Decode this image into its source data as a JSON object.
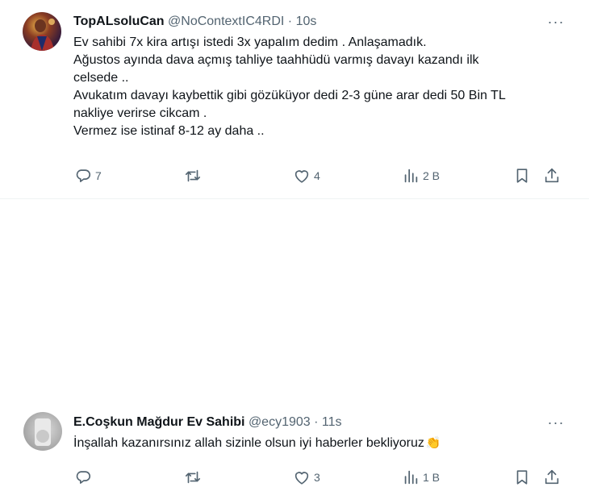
{
  "tweets": [
    {
      "display_name": "TopALsoluCan",
      "handle": "@NoContextIC4RDI",
      "separator": "·",
      "time": "10s",
      "text_lines": [
        "Ev sahibi 7x kira artışı istedi 3x yapalım dedim . Anlaşamadık.",
        "Ağustos ayında dava açmış tahliye taahhüdü varmış davayı kazandı ilk",
        "celsede ..",
        "Avukatım davayı kaybettik gibi gözüküyor dedi 2-3 güne arar dedi 50 Bin TL",
        "nakliye verirse cikcam .",
        "Vermez ise istinaf 8-12 ay daha .."
      ],
      "replies": "7",
      "retweets": "",
      "likes": "4",
      "views": "2 B"
    },
    {
      "display_name": "E.Coşkun Mağdur Ev Sahibi",
      "handle": "@ecy1903",
      "separator": "·",
      "time": "11s",
      "text_lines": [
        "İnşallah kazanırsınız allah sizinle olsun iyi haberler bekliyoruz"
      ],
      "emoji": "👏",
      "replies": "",
      "retweets": "",
      "likes": "3",
      "views": "1 B"
    }
  ],
  "icons": {
    "more": "more-horizontal-icon",
    "reply": "reply-icon",
    "retweet": "retweet-icon",
    "like": "heart-icon",
    "views": "views-chart-icon",
    "bookmark": "bookmark-icon",
    "share": "share-icon"
  },
  "colors": {
    "text": "#0f1419",
    "secondary": "#536471",
    "divider": "#eff3f4",
    "emoji": "#f2b233"
  }
}
